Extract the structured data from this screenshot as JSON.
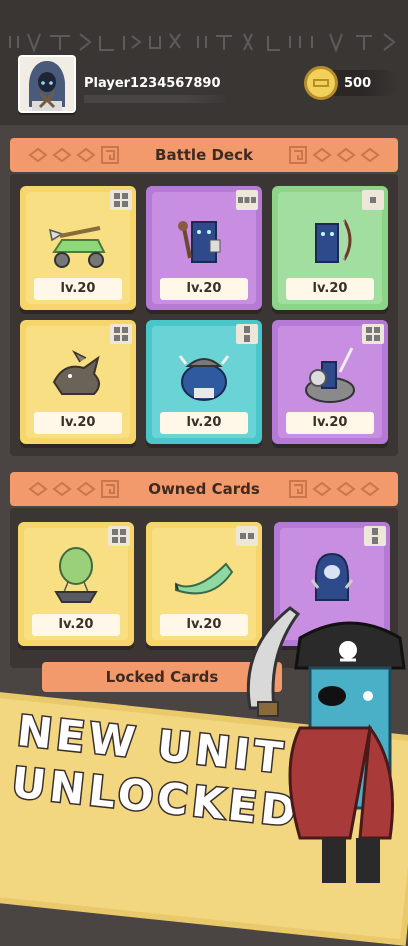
{
  "player": {
    "name": "Player1234567890"
  },
  "currency": {
    "amount": "500",
    "icon": "gold-coin-icon"
  },
  "battle_deck": {
    "title": "Battle Deck",
    "cards": [
      {
        "level": "lv.20",
        "color": "yellow",
        "unit": "catapult",
        "size_icon": "size-2x2-icon"
      },
      {
        "level": "lv.20",
        "color": "purple",
        "unit": "hooded-mage",
        "size_icon": "size-3x1-icon"
      },
      {
        "level": "lv.20",
        "color": "green",
        "unit": "archer",
        "size_icon": "size-1x1-icon"
      },
      {
        "level": "lv.20",
        "color": "yellow",
        "unit": "dragon",
        "size_icon": "size-2x2-icon"
      },
      {
        "level": "lv.20",
        "color": "teal",
        "unit": "viking-brute",
        "size_icon": "size-1x2-icon"
      },
      {
        "level": "lv.20",
        "color": "purple",
        "unit": "boar-rider",
        "size_icon": "size-2x2-icon"
      }
    ]
  },
  "owned_cards": {
    "title": "Owned Cards",
    "cards": [
      {
        "level": "lv.20",
        "color": "yellow",
        "unit": "airship",
        "size_icon": "size-2x2-icon"
      },
      {
        "level": "lv.20",
        "color": "yellow",
        "unit": "war-horn",
        "size_icon": "size-2x1-icon"
      },
      {
        "level": "",
        "color": "purple",
        "unit": "assassin",
        "size_icon": "size-1x2-icon"
      }
    ]
  },
  "locked_cards": {
    "title": "Locked Cards"
  },
  "promo": {
    "line1": "NEW UNIT",
    "line2": "UNLOCKED"
  },
  "colors": {
    "banner": "#f29a6b",
    "background": "#4a4542",
    "yellow_card": "#f6d66b",
    "purple_card": "#b57ad6",
    "green_card": "#8dd489",
    "teal_card": "#49c6c9"
  }
}
